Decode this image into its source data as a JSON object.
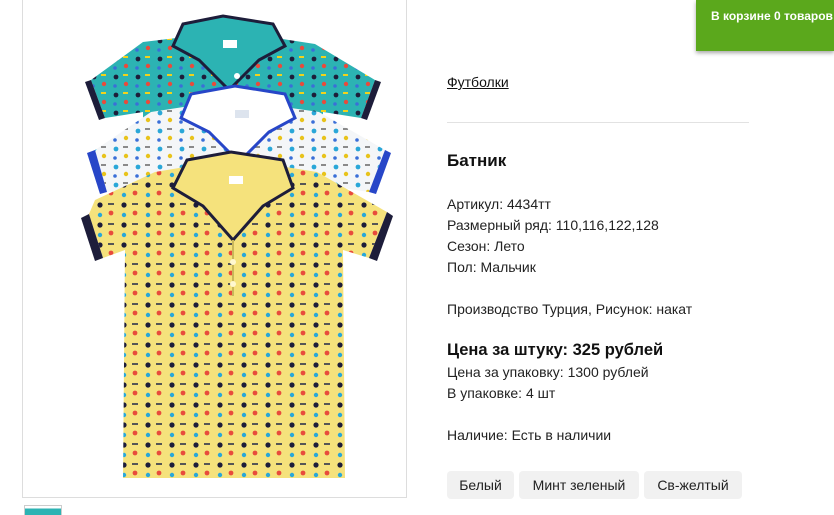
{
  "cart": {
    "label": "В корзине 0 товаров"
  },
  "breadcrumb": {
    "category": "Футболки"
  },
  "product": {
    "title": "Батник",
    "article": "Артикул: 4434тт",
    "sizes": "Размерный ряд: 110,116,122,128",
    "season": "Сезон: Лето",
    "gender": "Пол: Мальчик",
    "production": "Производство Турция, Рисунок: накат",
    "price_unit": "Цена за штуку: 325 рублей",
    "price_pack": "Цена за упаковку: 1300 рублей",
    "pack_count": "В упаковке: 4 шт",
    "availability": "Наличие: Есть в наличии"
  },
  "colors": [
    "Белый",
    "Минт зеленый",
    "Св-желтый"
  ],
  "theme": {
    "cart_green": "#5ba81c",
    "shirt_teal": "#2cb3b3",
    "shirt_white": "#f4f6f8",
    "shirt_yellow": "#f5e27c",
    "trim_navy": "#1d1d3a",
    "trim_blue": "#2746c8"
  }
}
